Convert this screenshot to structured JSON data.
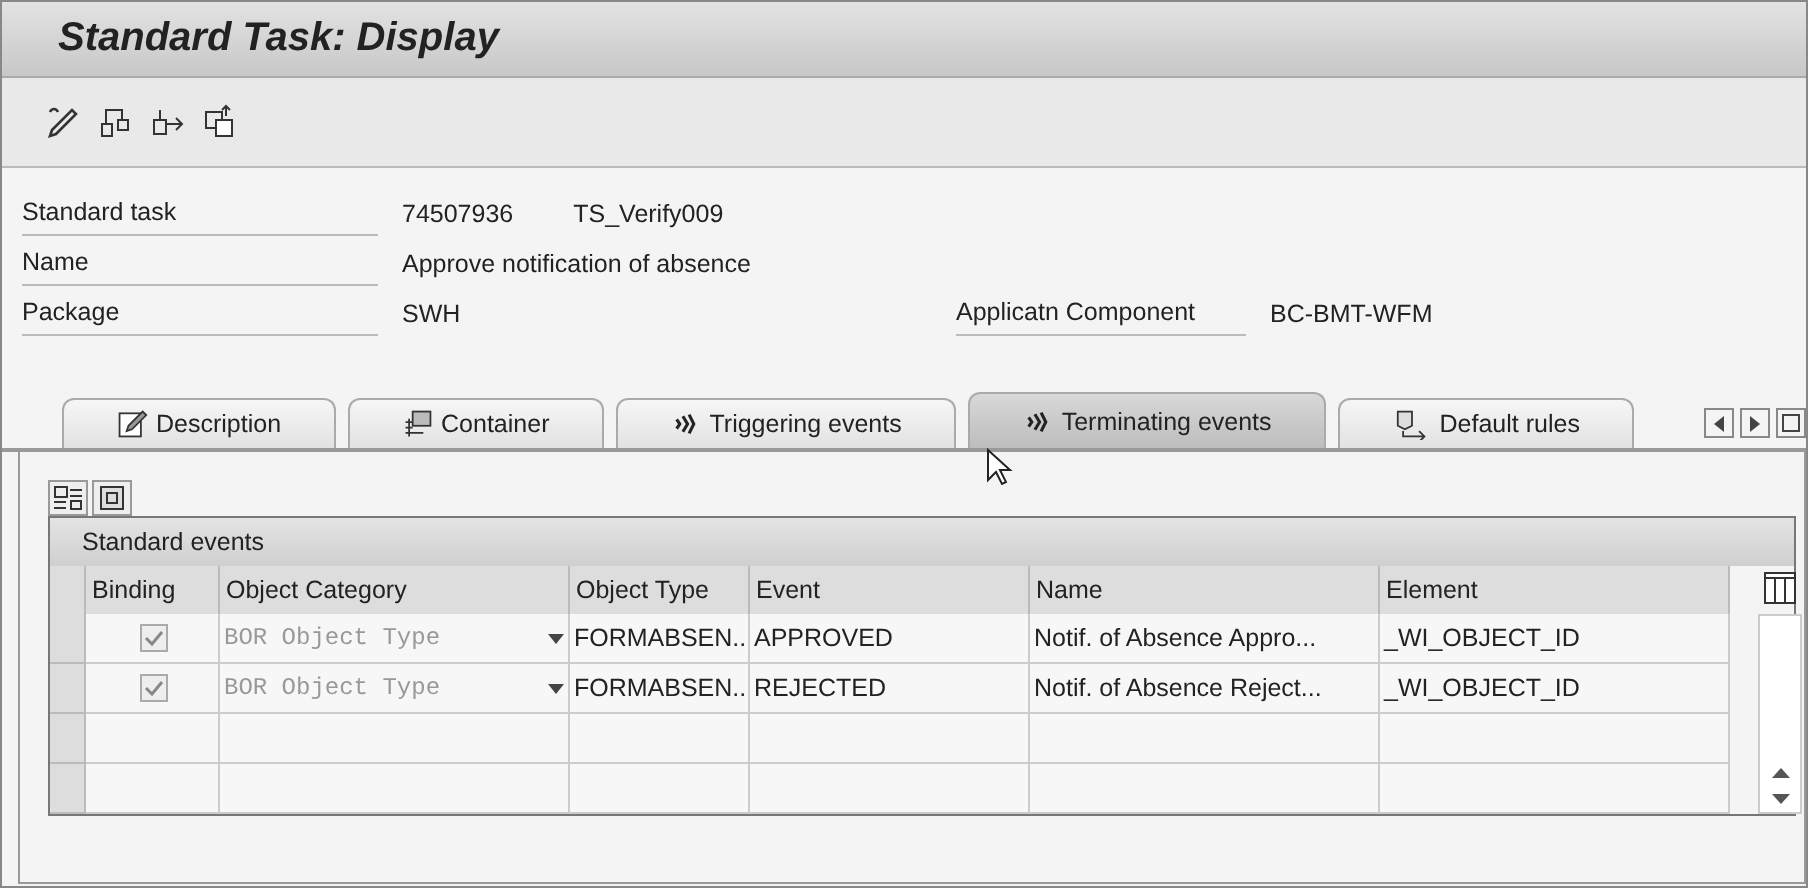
{
  "window": {
    "title": "Standard Task: Display"
  },
  "header_fields": [
    {
      "label": "Standard task",
      "values": [
        "74507936",
        "TS_Verify009"
      ]
    },
    {
      "label": "Name",
      "values": [
        "Approve notification of absence"
      ]
    },
    {
      "label": "Package",
      "values": [
        "SWH"
      ],
      "side_label": "Applicatn Component",
      "side_value": "BC-BMT-WFM"
    }
  ],
  "tabs": [
    {
      "label": "Description",
      "selected": false
    },
    {
      "label": "Container",
      "selected": false
    },
    {
      "label": "Triggering events",
      "selected": false
    },
    {
      "label": "Terminating events",
      "selected": true
    },
    {
      "label": "Default rules",
      "selected": false
    }
  ],
  "table": {
    "title": "Standard events",
    "columns": [
      "Binding",
      "Object Category",
      "Object Type",
      "Event",
      "Name",
      "Element"
    ],
    "rows": [
      {
        "binding": true,
        "category": "BOR Object Type",
        "object_type": "FORMABSEN..",
        "event": "APPROVED",
        "name": "Notif. of Absence Appro...",
        "element": "_WI_OBJECT_ID"
      },
      {
        "binding": true,
        "category": "BOR Object Type",
        "object_type": "FORMABSEN..",
        "event": "REJECTED",
        "name": "Notif. of Absence Reject...",
        "element": "_WI_OBJECT_ID"
      }
    ]
  }
}
